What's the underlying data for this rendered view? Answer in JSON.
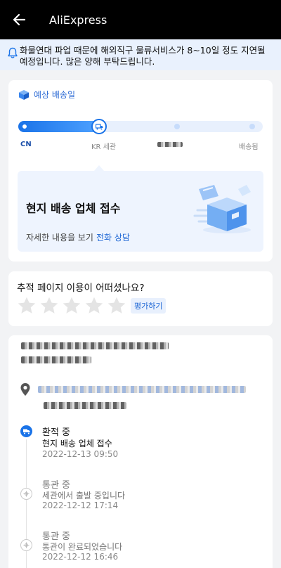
{
  "app": {
    "title": "AliExpress"
  },
  "notice": {
    "text": "화물연대 파업 때문에 해외직구 물류서비스가 8~10일 정도 지연될 예정입니다. 많은 양해 부탁드립니다."
  },
  "delivery": {
    "estimate_label": "예상 배송일",
    "progress_fraction": 0.33,
    "stages": [
      "CN",
      "KR 세관",
      "배송됨"
    ],
    "status_title": "현지 배송 업체 접수",
    "detail_prefix": "자세한 내용을 보기",
    "detail_link": "전화 상담"
  },
  "rating": {
    "question": "추적 페이지 이용이 어떠셨나요?",
    "star_count": 5,
    "rate_button": "평가하기"
  },
  "timeline": [
    {
      "status": "환적 중",
      "detail": "현지 배송 업체 접수",
      "time": "2022-12-13 09:50",
      "active": true
    },
    {
      "status": "통관 중",
      "detail": "세관에서 출발 중입니다",
      "time": "2022-12-12 17:14",
      "active": false
    },
    {
      "status": "통관 중",
      "detail": "통관이 완료되었습니다",
      "time": "2022-12-12 16:46",
      "active": false
    }
  ],
  "colors": {
    "accent": "#1a73e8",
    "appbar": "#000000",
    "notice_bg": "#e9f1fd",
    "page_bg": "#f2f3f5"
  },
  "icons": {
    "back": "arrow-left-icon",
    "notice": "bell-icon",
    "estimate": "package-icon",
    "current_stage": "truck-icon",
    "address": "location-pin-icon",
    "timeline_active": "truck-icon",
    "timeline_past": "customs-icon"
  }
}
